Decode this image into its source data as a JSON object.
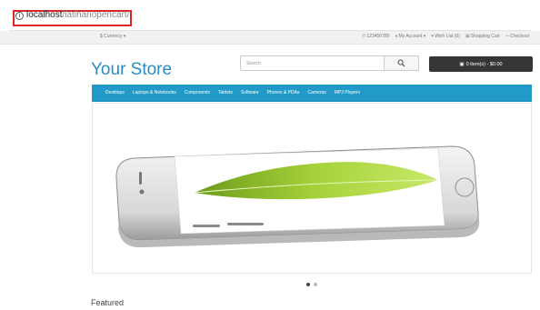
{
  "browser": {
    "url_host": "localhost",
    "url_path": "/latihanopencart/",
    "info_glyph": "i"
  },
  "topnav": {
    "currency": "$ Currency ▾",
    "phone": "123456789",
    "account": "My Account ▾",
    "wishlist": "Wish List (0)",
    "cart": "Shopping Cart",
    "checkout": "Checkout"
  },
  "header": {
    "store_title": "Your Store",
    "search_placeholder": "Search",
    "cart_button": "0 item(s) - $0.00"
  },
  "menu": {
    "items": [
      "Desktops",
      "Laptops & Notebooks",
      "Components",
      "Tablets",
      "Software",
      "Phones & PDAs",
      "Cameras",
      "MP3 Players"
    ]
  },
  "slideshow": {
    "active_index": 0,
    "slide_count": 2
  },
  "content": {
    "featured_heading": "Featured"
  },
  "colors": {
    "accent": "#229ac8",
    "title": "#2b8cc4",
    "cart_button": "#363636",
    "address_highlight": "#d9262b"
  }
}
